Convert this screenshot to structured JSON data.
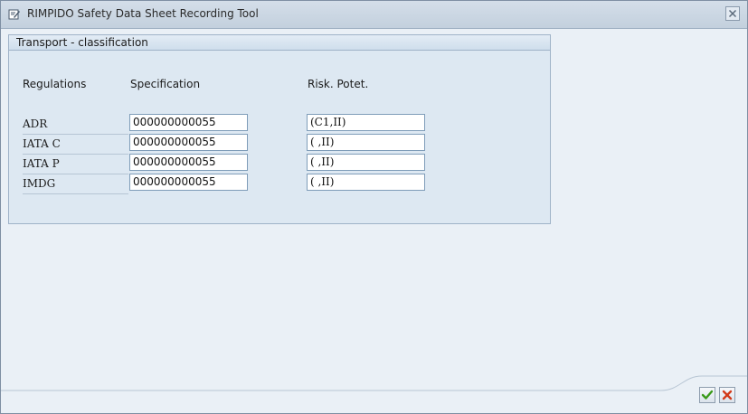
{
  "window": {
    "title": "RIMPIDO Safety Data Sheet Recording Tool",
    "icon": "dialog-edit-icon",
    "close_icon": "close-icon"
  },
  "group": {
    "title": "Transport - classification",
    "headers": {
      "regulations": "Regulations",
      "specification": "Specification",
      "risk": "Risk. Potet."
    },
    "rows": [
      {
        "regulation": "ADR",
        "specification": "000000000055",
        "risk": "(C1,II)"
      },
      {
        "regulation": "IATA C",
        "specification": "000000000055",
        "risk": "( ,II)"
      },
      {
        "regulation": "IATA P",
        "specification": "000000000055",
        "risk": "( ,II)"
      },
      {
        "regulation": "IMDG",
        "specification": "000000000055",
        "risk": "( ,II)"
      }
    ]
  },
  "footer": {
    "confirm_icon": "checkmark-icon",
    "cancel_icon": "cancel-x-icon",
    "confirm_color": "#3a9a1a",
    "cancel_color": "#d23a1a"
  }
}
